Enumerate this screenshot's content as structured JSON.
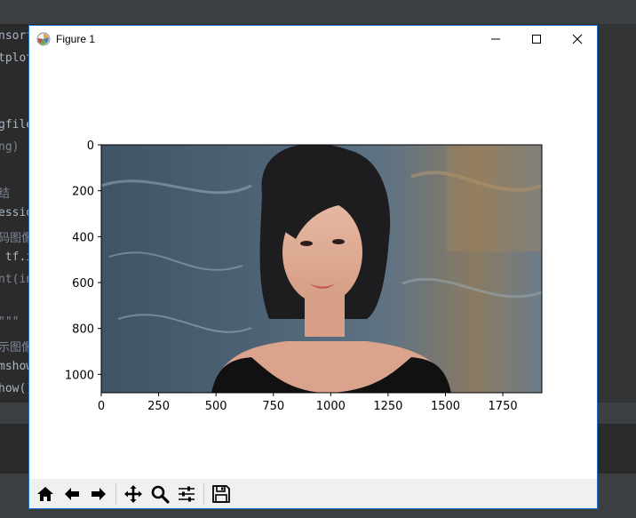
{
  "ide": {
    "code_lines": [
      {
        "text": "nsorf",
        "dim": false
      },
      {
        "text": "tplot",
        "dim": false
      },
      {
        "text": "",
        "dim": false
      },
      {
        "text": "gfile",
        "dim": false
      },
      {
        "text": "ng)",
        "dim": true
      },
      {
        "text": "结",
        "dim": true
      },
      {
        "text": "essio",
        "dim": false
      },
      {
        "text": "码图像",
        "dim": true
      },
      {
        "text": " tf.i",
        "dim": false
      },
      {
        "text": "nt(in",
        "dim": true
      },
      {
        "text": "\"\"\"",
        "dim": true
      },
      {
        "text": "示图像",
        "dim": true
      },
      {
        "text": "mshow",
        "dim": false
      },
      {
        "text": "how()",
        "dim": false
      }
    ]
  },
  "window": {
    "title": "Figure 1",
    "minimize_icon": "minimize-icon",
    "maximize_icon": "maximize-icon",
    "close_icon": "close-icon"
  },
  "chart_data": {
    "type": "image",
    "title": "",
    "xlabel": "",
    "ylabel": "",
    "xlim": [
      0,
      1920
    ],
    "ylim": [
      1080,
      0
    ],
    "x_ticks": [
      "0",
      "250",
      "500",
      "750",
      "1000",
      "1250",
      "1500",
      "1750"
    ],
    "y_ticks": [
      "0",
      "200",
      "400",
      "600",
      "800",
      "1000"
    ],
    "image_subject": "portrait photograph"
  },
  "toolbar": {
    "buttons": [
      {
        "name": "home-icon"
      },
      {
        "name": "back-arrow-icon"
      },
      {
        "name": "forward-arrow-icon"
      },
      {
        "name": "pan-move-icon"
      },
      {
        "name": "zoom-magnifier-icon"
      },
      {
        "name": "configure-subplots-icon"
      },
      {
        "name": "save-figure-icon"
      }
    ]
  }
}
